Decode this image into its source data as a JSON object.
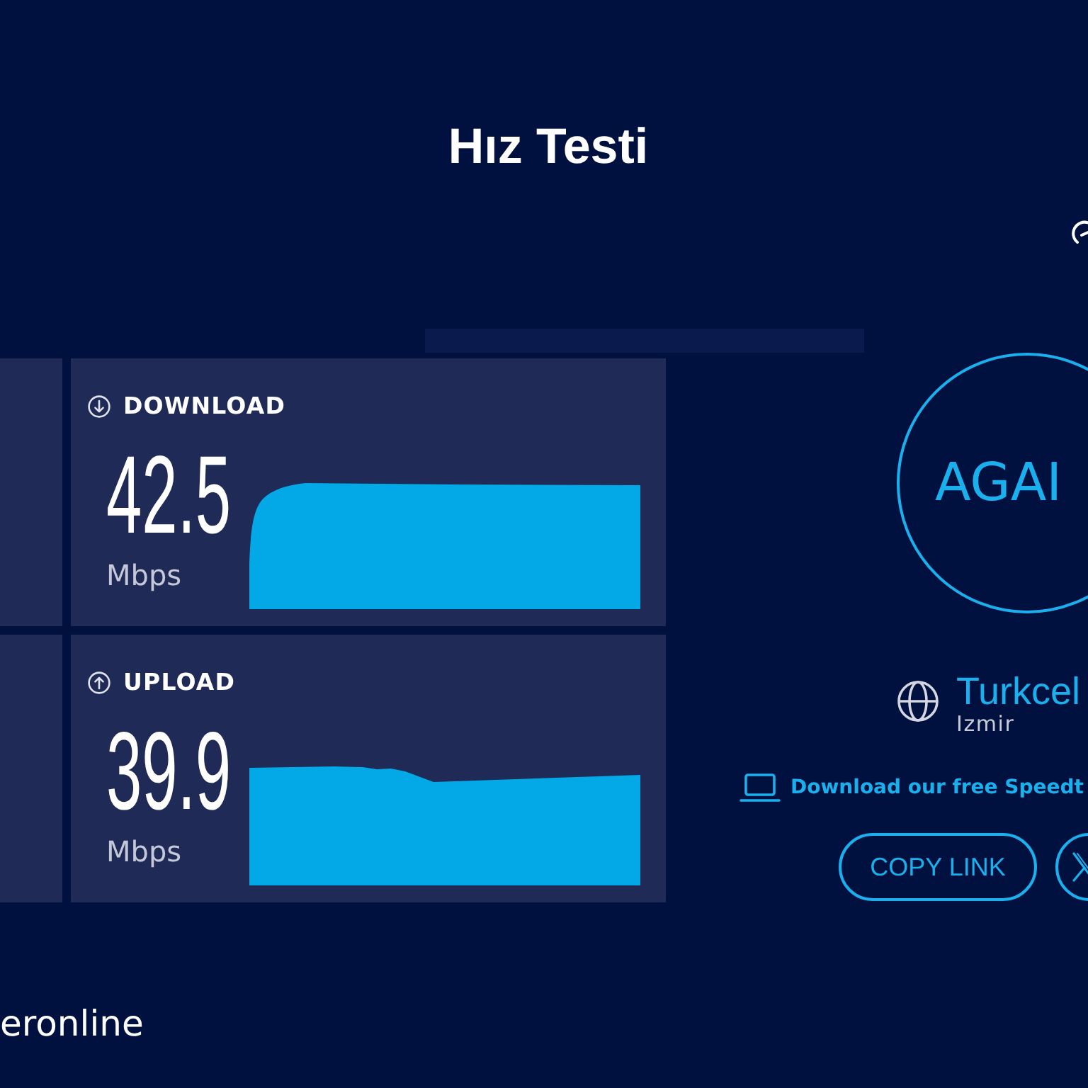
{
  "header": {
    "title": "Hız Testi"
  },
  "results": [
    {
      "kind": "download",
      "label": "DOWNLOAD",
      "value": "42.5",
      "unit": "Mbps"
    },
    {
      "kind": "upload",
      "label": "UPLOAD",
      "value": "39.9",
      "unit": "Mbps"
    }
  ],
  "again_button": {
    "label": "AGAI"
  },
  "server": {
    "provider": "Turkcel",
    "location": "Izmir"
  },
  "app_link": {
    "text": "Download our free Speedt"
  },
  "share_buttons": [
    {
      "kind": "copy",
      "label": "COPY LINK"
    },
    {
      "kind": "x"
    }
  ],
  "footer": {
    "text": "eronline"
  }
}
